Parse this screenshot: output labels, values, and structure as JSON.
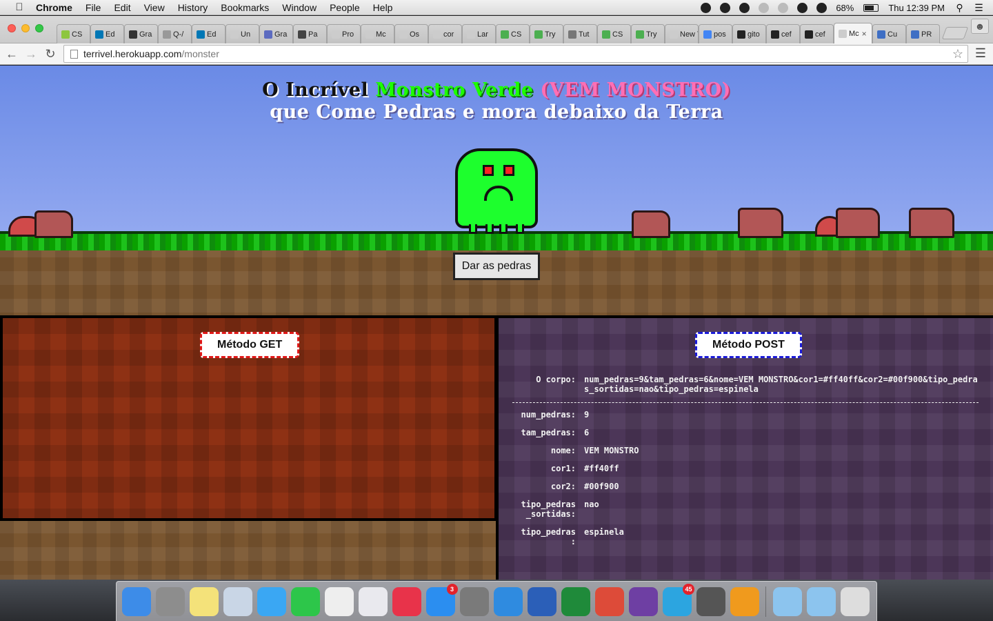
{
  "menubar": {
    "app": "Chrome",
    "items": [
      "File",
      "Edit",
      "View",
      "History",
      "Bookmarks",
      "Window",
      "People",
      "Help"
    ],
    "battery": "68%",
    "clock": "Thu 12:39 PM"
  },
  "tabs": [
    {
      "label": "CS",
      "color": "#8dc63f"
    },
    {
      "label": "Ed",
      "color": "#0077b5"
    },
    {
      "label": "Gra",
      "color": "#333333"
    },
    {
      "label": "Q-/",
      "color": "#999999"
    },
    {
      "label": "Ed",
      "color": "#0077b5"
    },
    {
      "label": "Un",
      "color": "#cccccc"
    },
    {
      "label": "Gra",
      "color": "#5c6bc0"
    },
    {
      "label": "Pa",
      "color": "#444444"
    },
    {
      "label": "Pro",
      "color": "#cccccc"
    },
    {
      "label": "Mc",
      "color": "#cccccc"
    },
    {
      "label": "Os",
      "color": "#cccccc"
    },
    {
      "label": "cor",
      "color": "#cccccc"
    },
    {
      "label": "Lar",
      "color": "#cccccc"
    },
    {
      "label": "CS",
      "color": "#4caf50"
    },
    {
      "label": "Try",
      "color": "#4caf50"
    },
    {
      "label": "Tut",
      "color": "#777777"
    },
    {
      "label": "CS",
      "color": "#4caf50"
    },
    {
      "label": "Try",
      "color": "#4caf50"
    },
    {
      "label": "New T",
      "color": "#cccccc"
    },
    {
      "label": "pos",
      "color": "#4285f4"
    },
    {
      "label": "gito",
      "color": "#222222"
    },
    {
      "label": "cef",
      "color": "#222222"
    },
    {
      "label": "cef",
      "color": "#222222"
    }
  ],
  "active_tab": {
    "label": "Mc",
    "close": "×"
  },
  "trailing_tabs": [
    {
      "label": "Cu",
      "color": "#3f6fc4"
    },
    {
      "label": "PR",
      "color": "#3f6fc4"
    }
  ],
  "address": {
    "domain": "terrivel.herokuapp.com",
    "path": "/monster"
  },
  "page": {
    "title_w1": "O Incrível",
    "title_w2": "Monstro Verde",
    "title_w3": "(VEM MONSTRO)",
    "title_line2": "que Come Pedras e mora debaixo da Terra",
    "button": "Dar as pedras",
    "colors": {
      "cor1": "#ff40ff",
      "cor2": "#00f900"
    }
  },
  "get_panel": {
    "label": "Método GET"
  },
  "post_panel": {
    "label": "Método POST",
    "body_key": "O corpo:",
    "body_value": "num_pedras=9&tam_pedras=6&nome=VEM MONSTRO&cor1=#ff40ff&cor2=#00f900&tipo_pedras_sortidas=nao&tipo_pedras=espinela",
    "fields": [
      {
        "key": "num_pedras:",
        "value": "9"
      },
      {
        "key": "tam_pedras:",
        "value": "6"
      },
      {
        "key": "nome:",
        "value": "VEM MONSTRO"
      },
      {
        "key": "cor1:",
        "value": "#ff40ff"
      },
      {
        "key": "cor2:",
        "value": "#00f900"
      },
      {
        "key": "tipo_pedras _sortidas:",
        "value": "nao"
      },
      {
        "key": "tipo_pedras :",
        "value": "espinela"
      }
    ]
  },
  "dock": {
    "apps": [
      {
        "name": "Finder",
        "color": "#3d8ce8"
      },
      {
        "name": "Launchpad",
        "color": "#8d8d8d"
      },
      {
        "name": "Notes",
        "color": "#f4e27a"
      },
      {
        "name": "Preview",
        "color": "#c9d6e6"
      },
      {
        "name": "Messages",
        "color": "#3aa7f3"
      },
      {
        "name": "FaceTime",
        "color": "#2dc64a"
      },
      {
        "name": "Clock",
        "color": "#eeeeee"
      },
      {
        "name": "Keynote",
        "color": "#e9e9ee"
      },
      {
        "name": "iTunes",
        "color": "#e8334a"
      },
      {
        "name": "App Store",
        "color": "#2b8ef0",
        "badge": "3"
      },
      {
        "name": "System Preferences",
        "color": "#7a7a7a"
      },
      {
        "name": "Safari",
        "color": "#2f8be0"
      },
      {
        "name": "Word",
        "color": "#2b5fb8"
      },
      {
        "name": "Excel",
        "color": "#1f8a3a"
      },
      {
        "name": "Chrome",
        "color": "#dd4b39"
      },
      {
        "name": "GitHub",
        "color": "#6e3fa3"
      },
      {
        "name": "Telegram",
        "color": "#2ca5e0",
        "badge": "45"
      },
      {
        "name": "Photo Booth",
        "color": "#555555"
      },
      {
        "name": "Sublime Text",
        "color": "#f09a1d"
      }
    ],
    "folders": [
      {
        "name": "Applications",
        "color": "#8cc4ee"
      },
      {
        "name": "Downloads",
        "color": "#8cc4ee"
      },
      {
        "name": "Trash",
        "color": "#dddddd"
      }
    ]
  }
}
